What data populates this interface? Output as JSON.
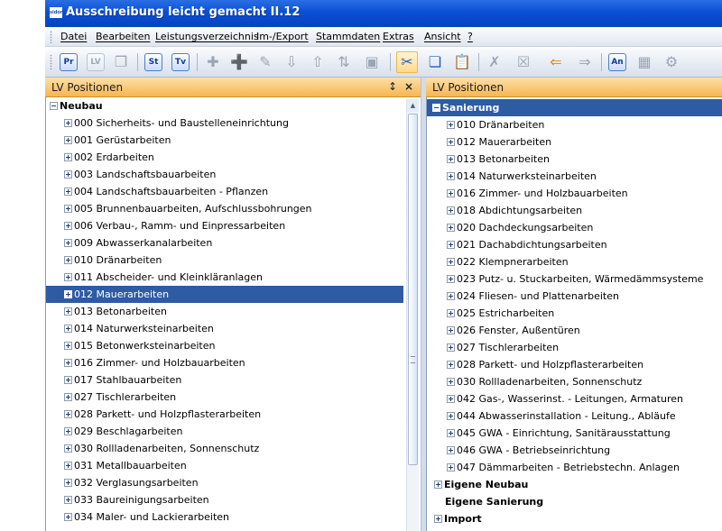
{
  "window": {
    "app_icon": "sidom",
    "title": "Ausschreibung leicht gemacht II.12"
  },
  "menu": [
    "Datei",
    "Bearbeiten",
    "Leistungsverzeichnis",
    "Im-/Export",
    "Stammdaten",
    "Extras",
    "Ansicht",
    "?"
  ],
  "toolbar": {
    "buttons": [
      {
        "name": "pr-button",
        "label": "Pr",
        "enabled": true
      },
      {
        "name": "lv-button",
        "label": "LV",
        "enabled": false
      },
      {
        "name": "copy-doc-icon",
        "label": "",
        "enabled": false
      },
      {
        "name": "st-button",
        "label": "St",
        "enabled": true
      },
      {
        "name": "tv-button",
        "label": "Tv",
        "enabled": true
      },
      {
        "name": "insert-icon",
        "label": "",
        "enabled": false
      },
      {
        "name": "add-icon",
        "label": "",
        "enabled": false
      },
      {
        "name": "edit-icon",
        "label": "",
        "enabled": false
      },
      {
        "name": "move-down-icon",
        "label": "",
        "enabled": false
      },
      {
        "name": "move-up-icon",
        "label": "",
        "enabled": false
      },
      {
        "name": "sort-icon",
        "label": "",
        "enabled": false
      },
      {
        "name": "save-icon",
        "label": "",
        "enabled": false
      },
      {
        "name": "cut-icon",
        "label": "",
        "enabled": true,
        "active": true
      },
      {
        "name": "copy-icon",
        "label": "",
        "enabled": true
      },
      {
        "name": "paste-icon",
        "label": "",
        "enabled": false
      },
      {
        "name": "delete-icon",
        "label": "",
        "enabled": false
      },
      {
        "name": "delete-all-icon",
        "label": "",
        "enabled": false
      },
      {
        "name": "arrow-left-icon",
        "label": "",
        "enabled": true
      },
      {
        "name": "arrow-right-icon",
        "label": "",
        "enabled": false
      },
      {
        "name": "an-button",
        "label": "An",
        "enabled": true
      },
      {
        "name": "form-icon",
        "label": "",
        "enabled": false
      },
      {
        "name": "tools-icon",
        "label": "",
        "enabled": false
      }
    ]
  },
  "left_panel": {
    "title": "LV Positionen",
    "pin_label": "↕",
    "close_label": "×",
    "root": "Neubau",
    "items": [
      "000 Sicherheits- und Baustelleneinrichtung",
      "001 Gerüstarbeiten",
      "002 Erdarbeiten",
      "003 Landschaftsbauarbeiten",
      "004 Landschaftsbauarbeiten - Pflanzen",
      "005 Brunnenbauarbeiten, Aufschlussbohrungen",
      "006 Verbau-, Ramm- und Einpressarbeiten",
      "009 Abwasserkanalarbeiten",
      "010 Dränarbeiten",
      "011 Abscheider- und Kleinkläranlagen",
      "012 Mauerarbeiten",
      "013 Betonarbeiten",
      "014 Naturwerksteinarbeiten",
      "015 Betonwerksteinarbeiten",
      "016 Zimmer- und Holzbauarbeiten",
      "017 Stahlbauarbeiten",
      "027 Tischlerarbeiten",
      "028 Parkett- und Holzpflasterarbeiten",
      "029 Beschlagarbeiten",
      "030 Rollladenarbeiten, Sonnenschutz",
      "031 Metallbauarbeiten",
      "032 Verglasungsarbeiten",
      "033 Baureinigungsarbeiten",
      "034 Maler- und Lackierarbeiten"
    ],
    "selected": "012 Mauerarbeiten"
  },
  "right_panel": {
    "title": "LV Positionen",
    "root": "Sanierung",
    "items": [
      "010 Dränarbeiten",
      "012 Mauerarbeiten",
      "013 Betonarbeiten",
      "014 Naturwerksteinarbeiten",
      "016 Zimmer- und Holzbauarbeiten",
      "018 Abdichtungsarbeiten",
      "020 Dachdeckungsarbeiten",
      "021 Dachabdichtungsarbeiten",
      "022 Klempnerarbeiten",
      "023 Putz- u. Stuckarbeiten, Wärmedämmsysteme",
      "024 Fliesen- und Plattenarbeiten",
      "025 Estricharbeiten",
      "026 Fenster, Außentüren",
      "027 Tischlerarbeiten",
      "028 Parkett- und Holzpflasterarbeiten",
      "030 Rollladenarbeiten, Sonnenschutz",
      "042 Gas-, Wasserinst. - Leitungen, Armaturen",
      "044 Abwasserinstallation - Leitung., Abläufe",
      "045 GWA - Einrichtung, Sanitärausstattung",
      "046 GWA - Betriebseinrichtung",
      "047 Dämmarbeiten - Betriebstechn. Anlagen"
    ],
    "other_roots": [
      {
        "label": "Eigene Neubau",
        "expandable": true
      },
      {
        "label": "Eigene Sanierung",
        "expandable": false
      },
      {
        "label": "Import",
        "expandable": true
      }
    ]
  },
  "colors": {
    "titlebar": "#0a4fd4",
    "panel_header": "#f6b650",
    "selection": "#2f5aa4"
  }
}
